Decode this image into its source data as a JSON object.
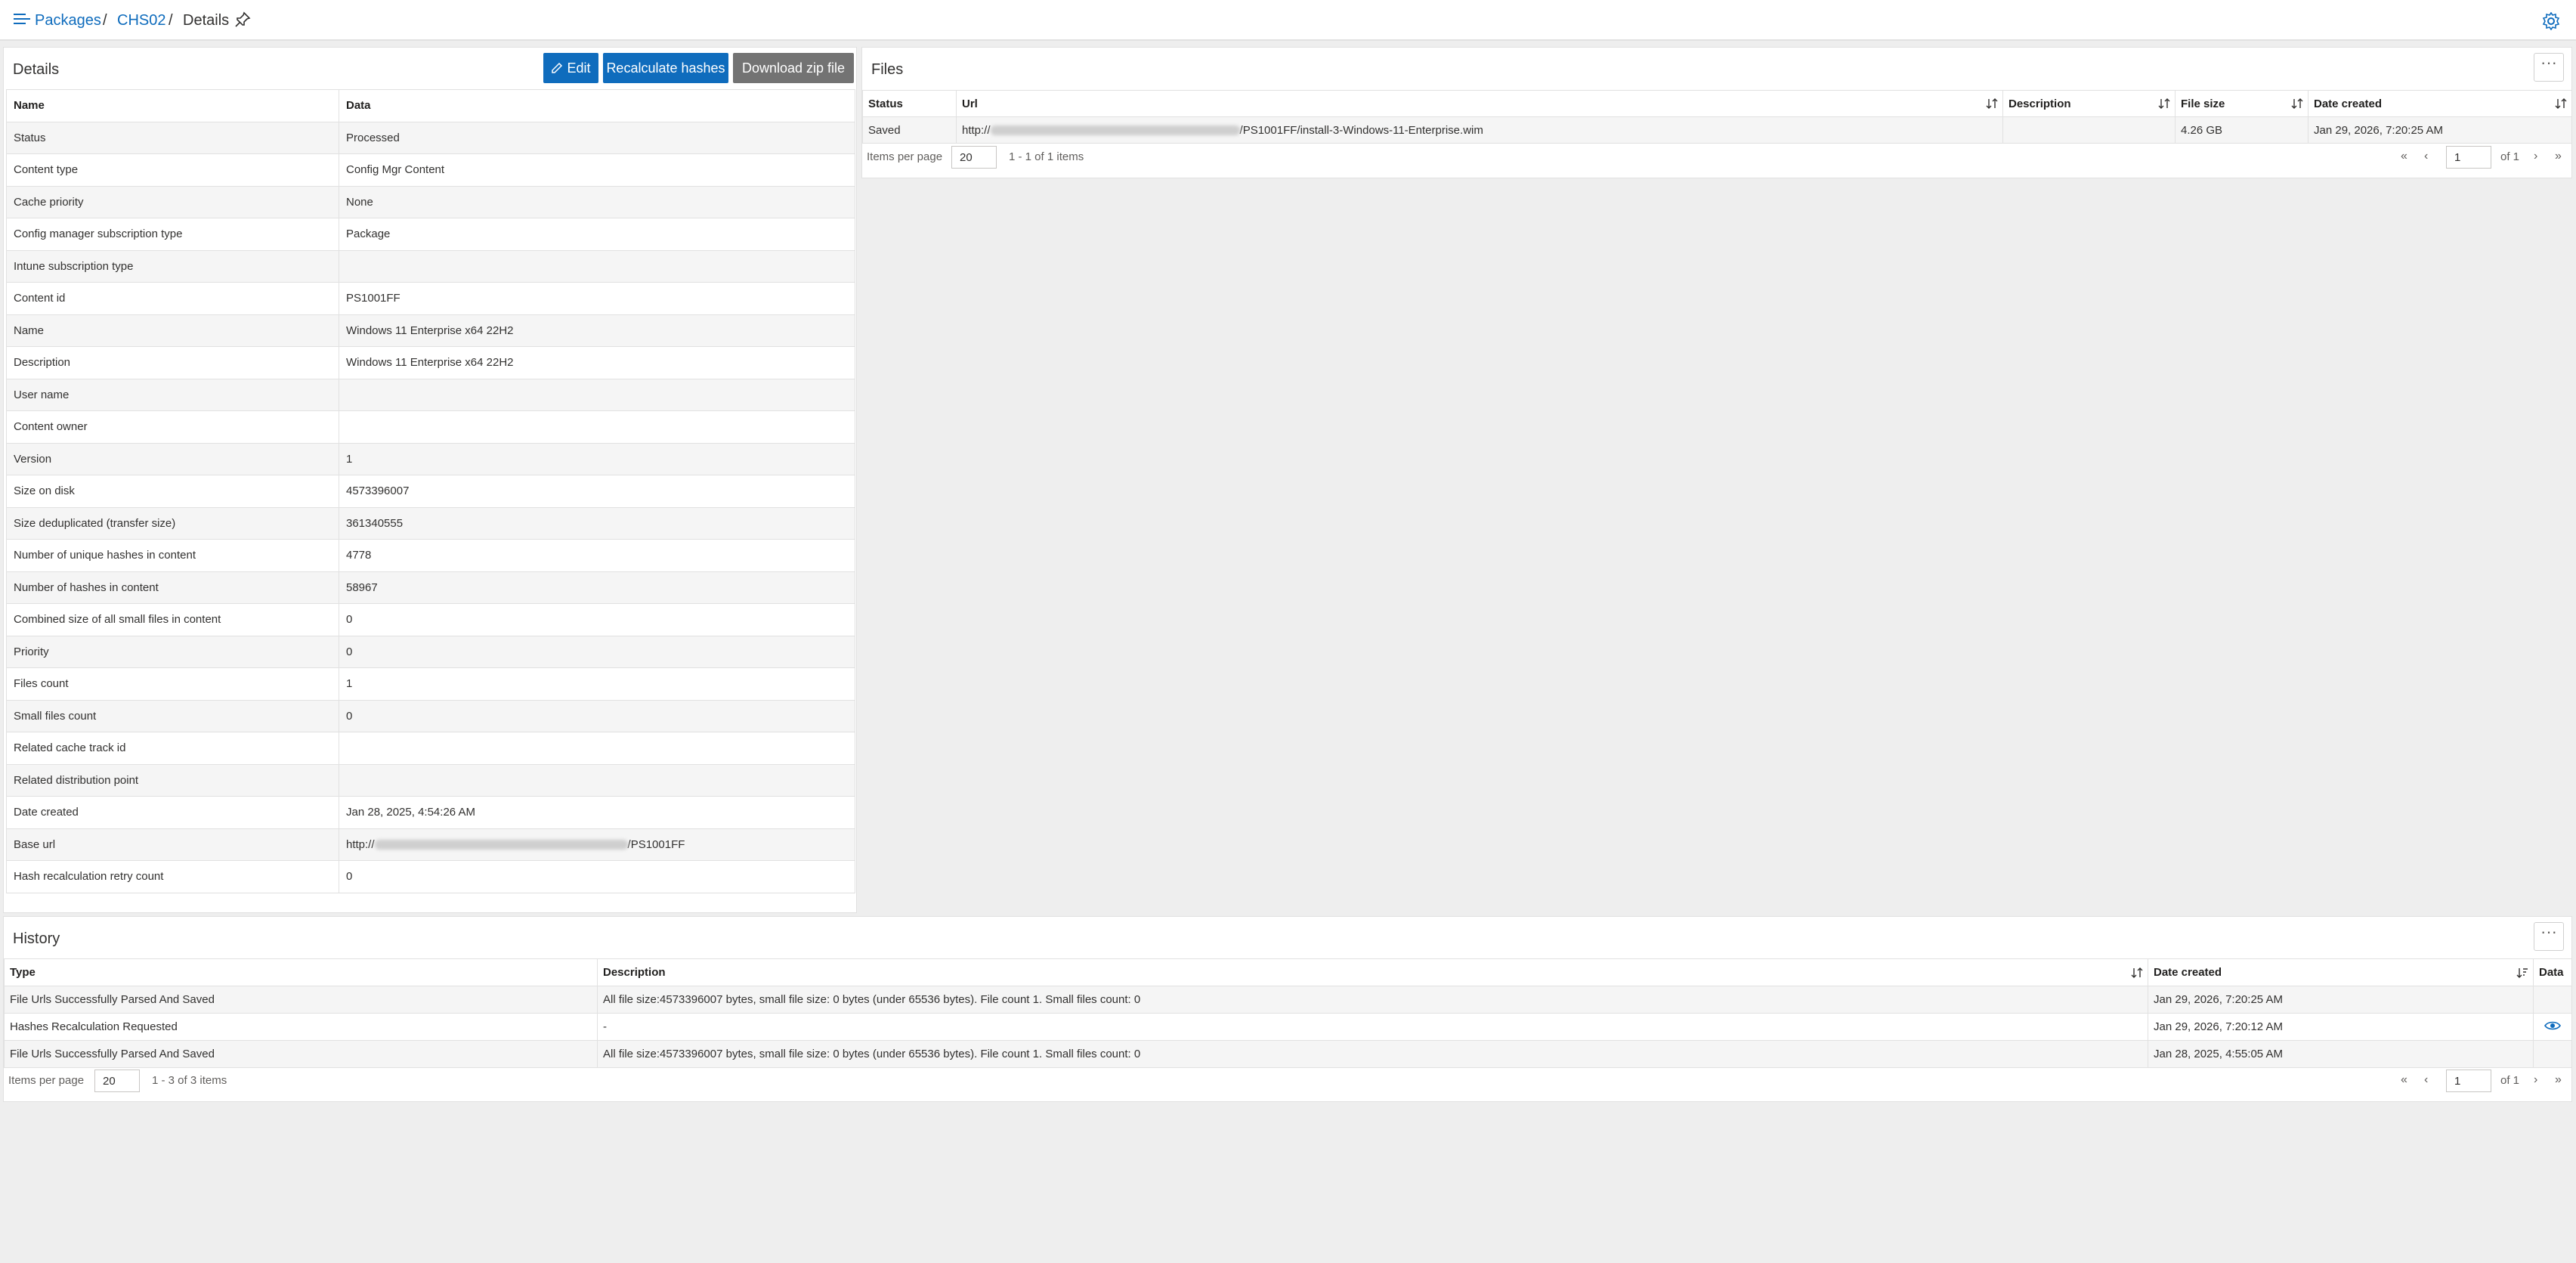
{
  "breadcrumb": {
    "items": [
      "Packages",
      "CHS02",
      "Details"
    ],
    "separator": "/"
  },
  "details": {
    "title": "Details",
    "buttons": {
      "edit": "Edit",
      "recalculate": "Recalculate hashes",
      "download": "Download zip file"
    },
    "headers": {
      "name": "Name",
      "data": "Data"
    },
    "rows": [
      {
        "name": "Status",
        "value": "Processed"
      },
      {
        "name": "Content type",
        "value": "Config Mgr Content"
      },
      {
        "name": "Cache priority",
        "value": "None"
      },
      {
        "name": "Config manager subscription type",
        "value": "Package"
      },
      {
        "name": "Intune subscription type",
        "value": ""
      },
      {
        "name": "Content id",
        "value": "PS1001FF"
      },
      {
        "name": "Name",
        "value": "Windows 11 Enterprise x64 22H2"
      },
      {
        "name": "Description",
        "value": "Windows 11 Enterprise x64 22H2"
      },
      {
        "name": "User name",
        "value": ""
      },
      {
        "name": "Content owner",
        "value": ""
      },
      {
        "name": "Version",
        "value": "1"
      },
      {
        "name": "Size on disk",
        "value": "4573396007"
      },
      {
        "name": "Size deduplicated (transfer size)",
        "value": "361340555"
      },
      {
        "name": "Number of unique hashes in content",
        "value": "4778"
      },
      {
        "name": "Number of hashes in content",
        "value": "58967"
      },
      {
        "name": "Combined size of all small files in content",
        "value": "0"
      },
      {
        "name": "Priority",
        "value": "0"
      },
      {
        "name": "Files count",
        "value": "1"
      },
      {
        "name": "Small files count",
        "value": "0"
      },
      {
        "name": "Related cache track id",
        "value": ""
      },
      {
        "name": "Related distribution point",
        "value": ""
      },
      {
        "name": "Date created",
        "value": "Jan 28, 2025, 4:54:26 AM"
      },
      {
        "name": "Base url",
        "value_prefix": "http://",
        "value_suffix": "/PS1001FF"
      },
      {
        "name": "Hash recalculation retry count",
        "value": "0"
      }
    ]
  },
  "files": {
    "title": "Files",
    "columns": {
      "status": "Status",
      "url": "Url",
      "description": "Description",
      "size": "File size",
      "date": "Date created"
    },
    "rows": [
      {
        "status": "Saved",
        "url_prefix": "http://",
        "url_suffix": "/PS1001FF/install-3-Windows-11-Enterprise.wim",
        "description": "",
        "size": "4.26 GB",
        "date": "Jan 29, 2026, 7:20:25 AM"
      }
    ],
    "pager": {
      "items_per_page_label": "Items per page",
      "page_size": "20",
      "range": "1 - 1 of 1 items",
      "page": "1",
      "of": "of 1"
    }
  },
  "history": {
    "title": "History",
    "columns": {
      "type": "Type",
      "description": "Description",
      "date": "Date created",
      "data": "Data"
    },
    "rows": [
      {
        "type": "File Urls Successfully Parsed And Saved",
        "description": "All file size:4573396007 bytes, small file size: 0 bytes (under 65536 bytes). File count 1. Small files count: 0",
        "date": "Jan 29, 2026, 7:20:25 AM"
      },
      {
        "type": "Hashes Recalculation Requested",
        "description": "-",
        "date": "Jan 29, 2026, 7:20:12 AM"
      },
      {
        "type": "File Urls Successfully Parsed And Saved",
        "description": "All file size:4573396007 bytes, small file size: 0 bytes (under 65536 bytes). File count 1. Small files count: 0",
        "date": "Jan 28, 2025, 4:55:05 AM"
      }
    ],
    "pager": {
      "items_per_page_label": "Items per page",
      "page_size": "20",
      "range": "1 - 3 of 3 items",
      "page": "1",
      "of": "of 1"
    }
  },
  "more_label": "···",
  "icons": [
    "menu-icon",
    "pin-icon",
    "settings-gear-icon",
    "edit-pencil-icon",
    "sort-icon",
    "eye-icon",
    "first-page-icon",
    "prev-page-icon",
    "next-page-icon",
    "last-page-icon"
  ],
  "colors": {
    "accent": "#0f6cbd",
    "gray_button": "#737373"
  }
}
